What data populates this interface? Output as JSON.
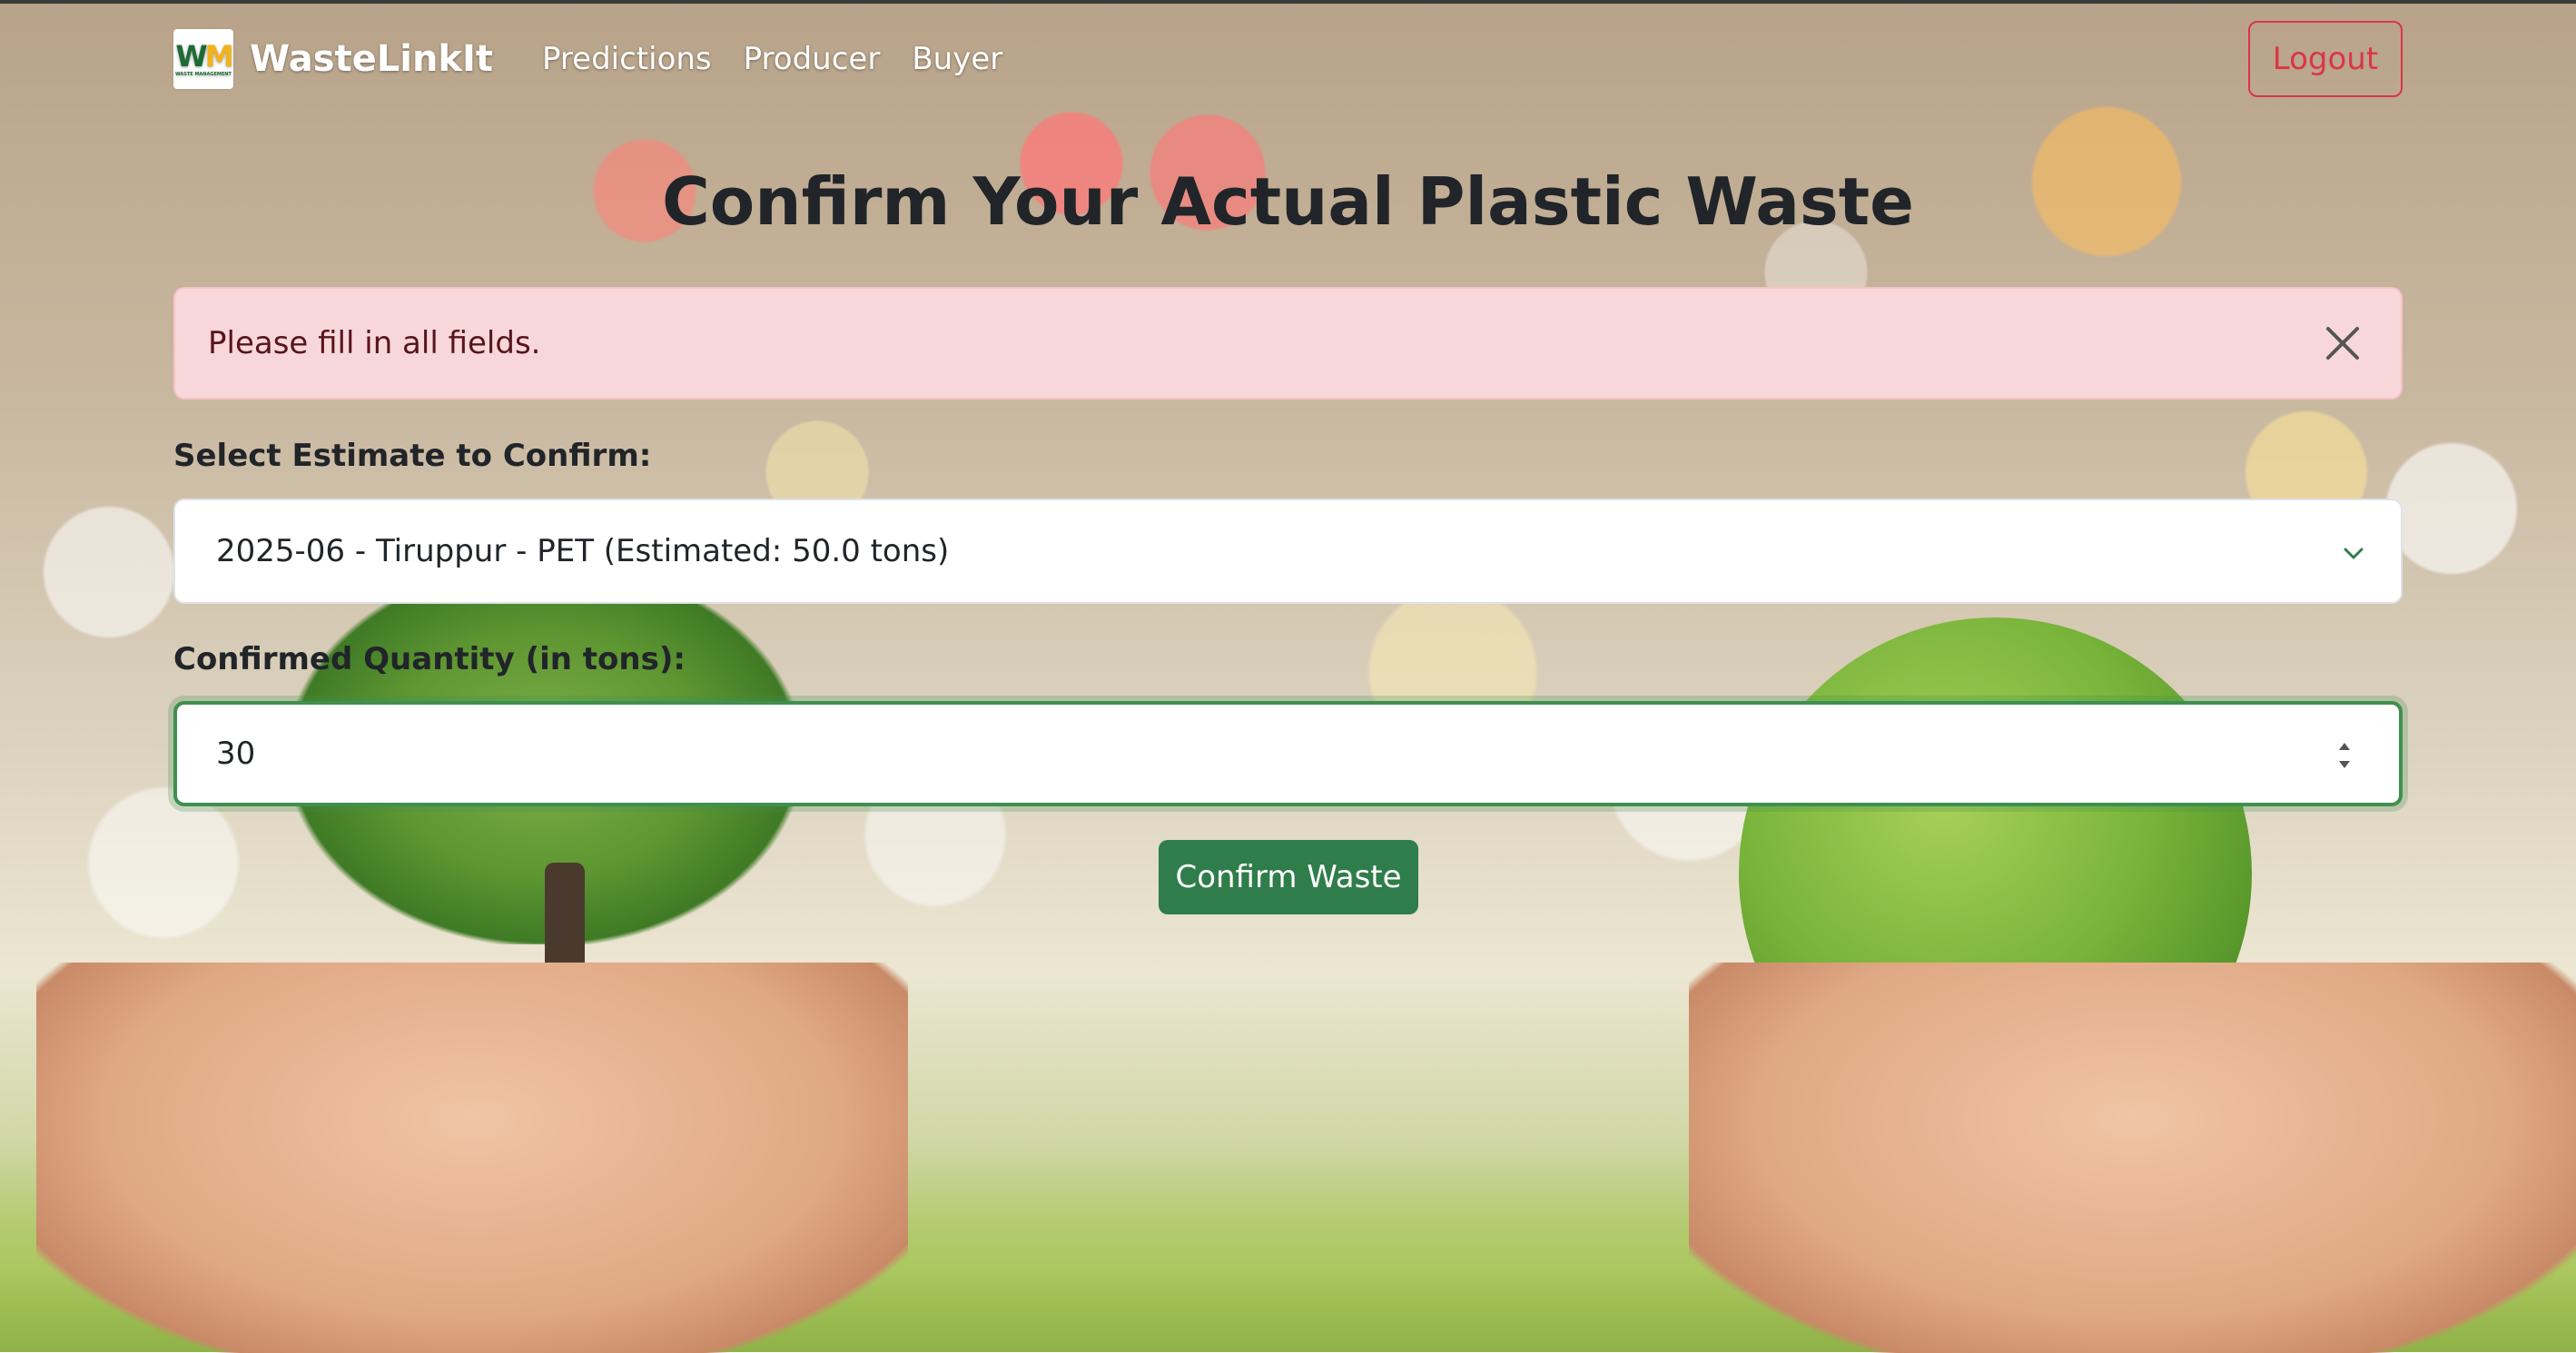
{
  "brand": {
    "logo_text_w": "W",
    "logo_text_m": "M",
    "logo_subtitle": "WASTE MANAGEMENT",
    "name": "WasteLinkIt"
  },
  "nav": {
    "links": [
      "Predictions",
      "Producer",
      "Buyer"
    ],
    "logout_label": "Logout"
  },
  "page": {
    "title": "Confirm Your Actual Plastic Waste"
  },
  "alert": {
    "message": "Please fill in all fields."
  },
  "form": {
    "estimate_label": "Select Estimate to Confirm:",
    "estimate_selected": "2025-06 - Tiruppur - PET (Estimated: 50.0 tons)",
    "quantity_label": "Confirmed Quantity (in tons):",
    "quantity_value": "30",
    "submit_label": "Confirm Waste"
  },
  "colors": {
    "primary_green": "#2f7d4a",
    "danger": "#dc3545",
    "alert_bg": "#f8d7da"
  }
}
